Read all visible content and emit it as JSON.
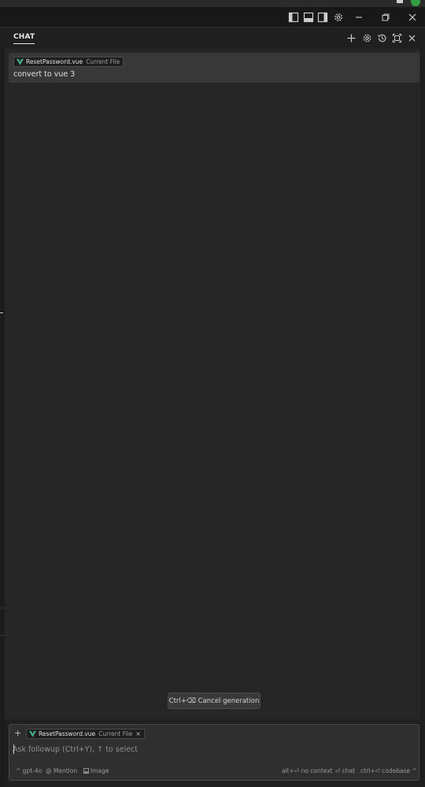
{
  "window": {
    "icons": [
      "toggle-primary-sidebar-icon",
      "toggle-panel-icon",
      "toggle-secondary-sidebar-icon",
      "settings-gear-icon",
      "minimize-icon",
      "restore-icon",
      "close-icon"
    ]
  },
  "panel": {
    "tab_label": "CHAT",
    "icons": [
      "new-chat-plus-icon",
      "chat-settings-icon",
      "history-icon",
      "maximize-icon",
      "close-panel-icon"
    ]
  },
  "message": {
    "file_name": "ResetPassword.vue",
    "file_tag": "Current File",
    "text": "convert to vue 3"
  },
  "cancel": {
    "label": "Ctrl+⌫ Cancel generation"
  },
  "input": {
    "add_label": "+",
    "file_name": "ResetPassword.vue",
    "file_tag": "Current File",
    "close_label": "×",
    "placeholder": "Ask followup (Ctrl+Y), ↑ to select"
  },
  "footer": {
    "model": "^ gpt-4o",
    "mention": "@ Mention",
    "image": "Image",
    "no_context": "alt+⏎ no context",
    "chat": "⏎ chat",
    "codebase": "ctrl+⏎ codebase ^"
  },
  "colors": {
    "vue_green": "#41b883",
    "vue_dark": "#34495e",
    "background": "#1f1f1f",
    "chat_area": "#262626"
  }
}
